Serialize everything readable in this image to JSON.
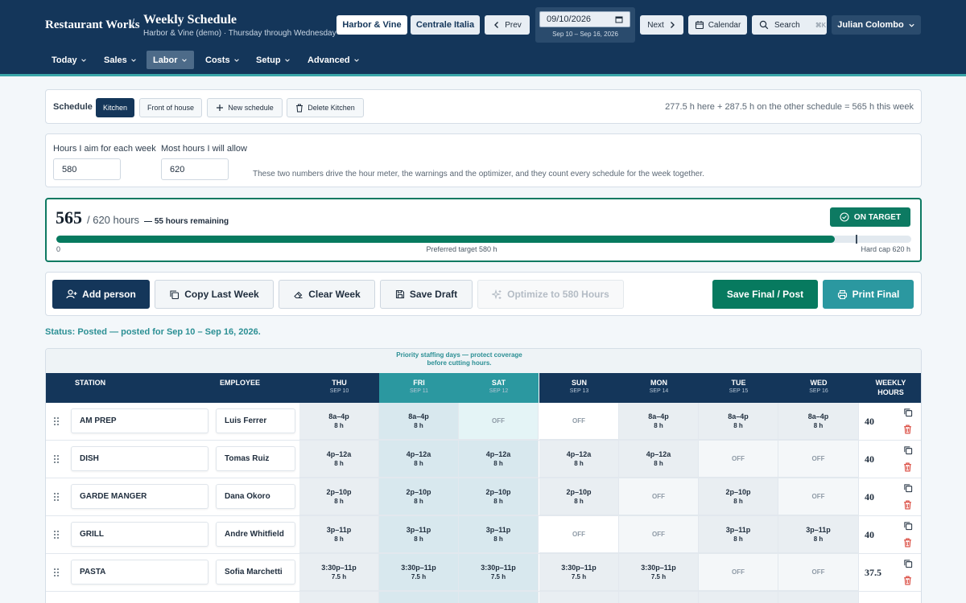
{
  "app": {
    "brand": "Restaurant Works",
    "title": "Weekly Schedule",
    "subtitle": "Harbor & Vine (demo) · Thursday through Wednesday"
  },
  "topbar": {
    "loc_primary": "Harbor & Vine",
    "loc_secondary": "Centrale Italia",
    "prev": "Prev",
    "date_value": "09/10/2026",
    "date_range": "Sep 10 – Sep 16, 2026",
    "next": "Next",
    "calendar": "Calendar",
    "search": "Search",
    "search_shortcut": "⌘K",
    "user": "Julian Colombo"
  },
  "nav": [
    "Today",
    "Sales",
    "Labor",
    "Costs",
    "Setup",
    "Advanced"
  ],
  "schedule_bar": {
    "label": "Schedule",
    "tab_kitchen": "Kitchen",
    "tab_foh": "Front of house",
    "new": "New schedule",
    "delete": "Delete Kitchen",
    "summary": "277.5 h here + 287.5 h on the other schedule = 565 h this week"
  },
  "targets": {
    "aim_label": "Hours I aim for each week",
    "aim_value": "580",
    "max_label": "Most hours I will allow",
    "max_value": "620",
    "note": "These two numbers drive the hour meter, the warnings and the optimizer, and they count every schedule for the week together."
  },
  "meter": {
    "hours": "565",
    "cap_text": "/ 620 hours",
    "remaining": "— 55 hours remaining",
    "badge": "ON TARGET",
    "fill": 0.911,
    "marker": 0.935,
    "left": "0",
    "mid": "Preferred target 580 h",
    "right": "Hard cap 620 h",
    "fill_color": "#077a5f"
  },
  "actions": {
    "add": "Add person",
    "copy": "Copy Last Week",
    "clear": "Clear Week",
    "draft": "Save Draft",
    "optimize": "Optimize to 580 Hours",
    "final": "Save Final / Post",
    "print": "Print Final"
  },
  "status": "Status: Posted — posted for Sep 10 – Sep 16, 2026.",
  "grid": {
    "priority_note": [
      "Priority staffing days — protect coverage",
      "before cutting hours."
    ],
    "col_station": "STATION",
    "col_employee": "EMPLOYEE",
    "col_weekly": "WEEKLY HOURS",
    "days": [
      {
        "d": "THU",
        "s": "SEP 10"
      },
      {
        "d": "FRI",
        "s": "SEP 11"
      },
      {
        "d": "SAT",
        "s": "SEP 12"
      },
      {
        "d": "SUN",
        "s": "SEP 13"
      },
      {
        "d": "MON",
        "s": "SEP 14"
      },
      {
        "d": "TUE",
        "s": "SEP 15"
      },
      {
        "d": "WED",
        "s": "SEP 16"
      }
    ],
    "rows": [
      {
        "station": "AM PREP",
        "employee": "Luis Ferrer",
        "weekly": "40",
        "cells": [
          [
            "8a–4p",
            "8 h"
          ],
          [
            "8a–4p",
            "8 h"
          ],
          [
            "OFF"
          ],
          [
            "OFF"
          ],
          [
            "8a–4p",
            "8 h"
          ],
          [
            "8a–4p",
            "8 h"
          ],
          [
            "8a–4p",
            "8 h"
          ]
        ]
      },
      {
        "station": "DISH",
        "employee": "Tomas Ruiz",
        "weekly": "40",
        "cells": [
          [
            "4p–12a",
            "8 h"
          ],
          [
            "4p–12a",
            "8 h"
          ],
          [
            "4p–12a",
            "8 h"
          ],
          [
            "4p–12a",
            "8 h"
          ],
          [
            "4p–12a",
            "8 h"
          ],
          [
            "OFF"
          ],
          [
            "OFF"
          ]
        ]
      },
      {
        "station": "GARDE MANGER",
        "employee": "Dana Okoro",
        "weekly": "40",
        "cells": [
          [
            "2p–10p",
            "8 h"
          ],
          [
            "2p–10p",
            "8 h"
          ],
          [
            "2p–10p",
            "8 h"
          ],
          [
            "2p–10p",
            "8 h"
          ],
          [
            "OFF"
          ],
          [
            "2p–10p",
            "8 h"
          ],
          [
            "OFF"
          ]
        ]
      },
      {
        "station": "GRILL",
        "employee": "Andre Whitfield",
        "weekly": "40",
        "cells": [
          [
            "3p–11p",
            "8 h"
          ],
          [
            "3p–11p",
            "8 h"
          ],
          [
            "3p–11p",
            "8 h"
          ],
          [
            "OFF"
          ],
          [
            "OFF"
          ],
          [
            "3p–11p",
            "8 h"
          ],
          [
            "3p–11p",
            "8 h"
          ]
        ]
      },
      {
        "station": "PASTA",
        "employee": "Sofia Marchetti",
        "weekly": "37.5",
        "cells": [
          [
            "3:30p–11p",
            "7.5 h"
          ],
          [
            "3:30p–11p",
            "7.5 h"
          ],
          [
            "3:30p–11p",
            "7.5 h"
          ],
          [
            "3:30p–11p",
            "7.5 h"
          ],
          [
            "3:30p–11p",
            "7.5 h"
          ],
          [
            "OFF"
          ],
          [
            "OFF"
          ]
        ]
      }
    ]
  }
}
